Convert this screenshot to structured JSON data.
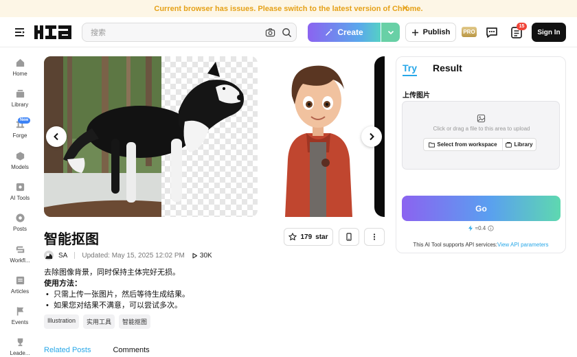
{
  "banner": {
    "text": "Current browser has issues. Please switch to the latest version of Chrome.",
    "close_glyph": "✕"
  },
  "header": {
    "search_placeholder": "搜索",
    "create_label": "Create",
    "publish_label": "Publish",
    "pro_label": "PRO",
    "notifications_count": "15",
    "signin_label": "Sign In"
  },
  "sidebar": {
    "items": [
      {
        "label": "Home",
        "icon": "home-icon"
      },
      {
        "label": "Library",
        "icon": "library-icon"
      },
      {
        "label": "Forge",
        "icon": "forge-icon",
        "badge": "New"
      },
      {
        "label": "Models",
        "icon": "models-icon"
      },
      {
        "label": "AI Tools",
        "icon": "ai-tools-icon"
      },
      {
        "label": "Posts",
        "icon": "posts-icon"
      },
      {
        "label": "Workfl...",
        "icon": "workflow-icon"
      },
      {
        "label": "Articles",
        "icon": "articles-icon"
      },
      {
        "label": "Events",
        "icon": "events-icon"
      },
      {
        "label": "Leade...",
        "icon": "leaderboard-icon"
      }
    ]
  },
  "tool": {
    "title": "智能抠图",
    "star_count": "179",
    "star_label": "star",
    "author": "SA",
    "updated": "Updated: May 15, 2025 12:02 PM",
    "views": "30K",
    "description": "去除图像背景，同时保持主体完好无损。",
    "usage_heading": "使用方法：",
    "usage_steps": [
      "只需上传一张图片，然后等待生成结果。",
      "如果您对结果不满意，可以尝试多次。"
    ],
    "tags": [
      "Illustration",
      "实用工具",
      "智能抠图"
    ]
  },
  "bottom_tabs": {
    "related": "Related Posts",
    "comments": "Comments"
  },
  "panel": {
    "tab_try": "Try",
    "tab_result": "Result",
    "upload_label": "上传图片",
    "upload_hint": "Click or drag a file to this area to upload",
    "workspace_button": "Select from workspace",
    "library_button": "Library",
    "go_label": "Go",
    "cost": "≈0.4"
  },
  "api": {
    "text": "This AI Tool supports API services:",
    "link": "View API parameters"
  },
  "colors": {
    "accent": "#27a7e8",
    "banner_text": "#e5a118",
    "banner_bg": "#fdf6e6"
  }
}
